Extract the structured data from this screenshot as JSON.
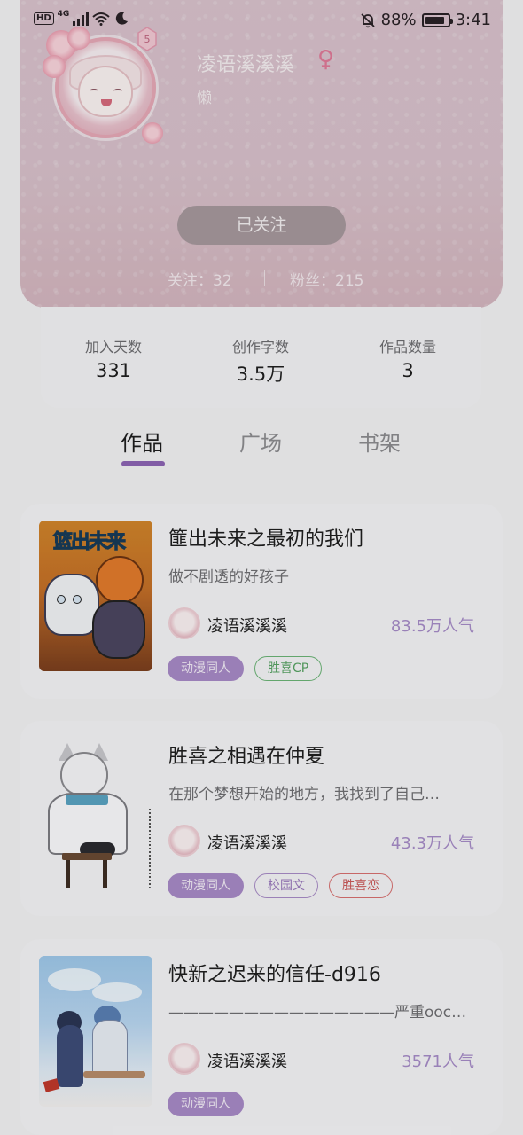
{
  "status_bar": {
    "hd": "HD",
    "network": "4G",
    "battery_percent": "88%",
    "battery_level": 0.88,
    "time": "3:41"
  },
  "profile": {
    "username": "凌语溪溪溪",
    "gender_symbol": "♀",
    "bio": "懒",
    "follow_button": "已关注",
    "following_label": "关注：32",
    "fans_label": "粉丝：215"
  },
  "stats": [
    {
      "label": "加入天数",
      "value": "331"
    },
    {
      "label": "创作字数",
      "value": "3.5万"
    },
    {
      "label": "作品数量",
      "value": "3"
    }
  ],
  "tabs": [
    {
      "label": "作品",
      "active": true
    },
    {
      "label": "广场",
      "active": false
    },
    {
      "label": "书架",
      "active": false
    }
  ],
  "works": [
    {
      "title": "篚出未来之最初的我们",
      "description": "做不剧透的好孩子",
      "author": "凌语溪溪溪",
      "popularity": "83.5万人气",
      "cover_text": "篮出未来",
      "tags": [
        {
          "label": "动漫同人",
          "style": "purple-fill"
        },
        {
          "label": "胜喜CP",
          "style": "green"
        }
      ]
    },
    {
      "title": "胜喜之相遇在仲夏",
      "description": "在那个梦想开始的地方，我找到了自己…",
      "author": "凌语溪溪溪",
      "popularity": "43.3万人气",
      "tags": [
        {
          "label": "动漫同人",
          "style": "purple-fill"
        },
        {
          "label": "校园文",
          "style": "purple"
        },
        {
          "label": "胜喜恋",
          "style": "red"
        }
      ]
    },
    {
      "title": "快新之迟来的信任-d916",
      "description": "———————————————严重ooc…",
      "author": "凌语溪溪溪",
      "popularity": "3571人气",
      "tags": [
        {
          "label": "动漫同人",
          "style": "purple-fill"
        }
      ]
    }
  ],
  "colors": {
    "accent_purple": "#a88ac7",
    "tab_indicator": "#8d64b4",
    "gender_pink": "#e07a98",
    "popularity_purple": "#a78cc8"
  }
}
